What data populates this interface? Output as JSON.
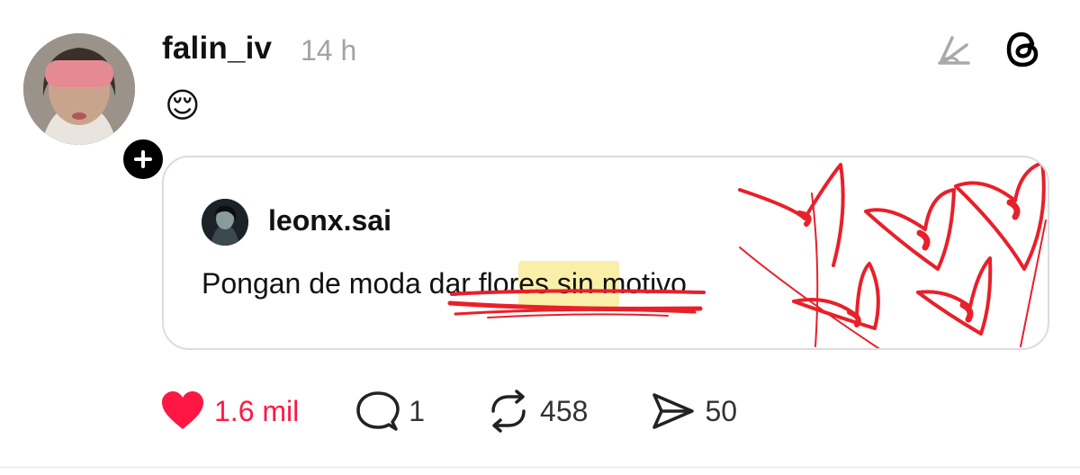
{
  "post": {
    "username": "falin_iv",
    "timestamp": "14 h",
    "body_emoji": "😌"
  },
  "quote": {
    "username": "leonx.sai",
    "text": "Pongan de moda dar flores sin motivo"
  },
  "actions": {
    "likes": "1.6 mil",
    "replies": "1",
    "reposts": "458",
    "shares": "50"
  },
  "icons": {
    "like": "heart-filled-icon",
    "reply": "speech-bubble-icon",
    "repost": "repost-arrows-icon",
    "share": "paper-plane-icon",
    "edit": "draw-icon",
    "brand": "threads-logo-icon",
    "follow": "plus-icon"
  },
  "colors": {
    "like_active": "#ff1744",
    "scribble_red": "#e8202a",
    "highlight": "#f8ec9a"
  }
}
